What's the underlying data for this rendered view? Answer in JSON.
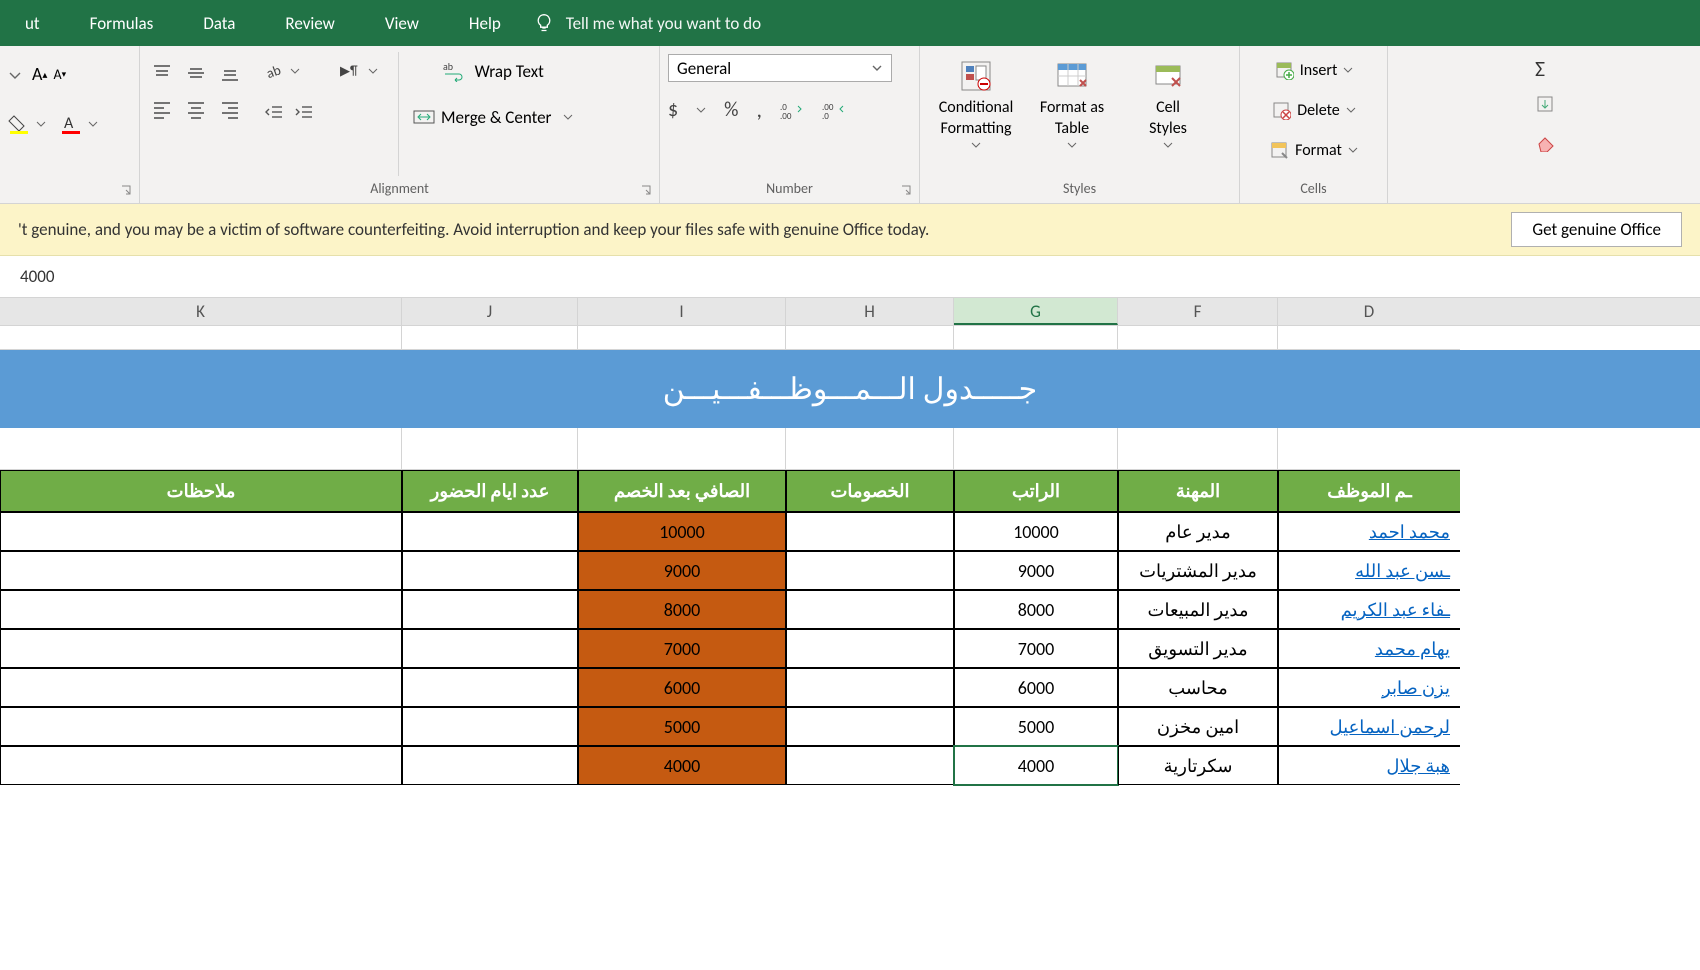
{
  "menu": {
    "tabs": [
      "ut",
      "Formulas",
      "Data",
      "Review",
      "View",
      "Help"
    ],
    "tellme": "Tell me what you want to do"
  },
  "ribbon": {
    "alignment_label": "Alignment",
    "number_label": "Number",
    "styles_label": "Styles",
    "cells_label": "Cells",
    "wrap_text": "Wrap Text",
    "merge_center": "Merge & Center",
    "number_format": "General",
    "cond_fmt": "Conditional\nFormatting",
    "fmt_table": "Format as\nTable",
    "cell_styles": "Cell\nStyles",
    "insert": "Insert",
    "delete": "Delete",
    "format": "Format"
  },
  "warning": {
    "message": "'t genuine, and you may be a victim of software counterfeiting. Avoid interruption and keep your files safe with genuine Office today.",
    "button": "Get genuine Office"
  },
  "formula_bar": "4000",
  "columns": [
    "K",
    "J",
    "I",
    "H",
    "G",
    "F",
    "D"
  ],
  "title_banner": "جـــــدول الـــمـــوظـــفـــيـــن",
  "headers": {
    "k": "ملاحظات",
    "j": "عدد ايام الحضور",
    "i": "الصافي بعد الخصم",
    "h": "الخصومات",
    "g": "الراتب",
    "f": "المهنة",
    "d": "ـم الموظف"
  },
  "rows": [
    {
      "net": "10000",
      "sal": "10000",
      "job": "مدير عام",
      "name": "محمد احمد"
    },
    {
      "net": "9000",
      "sal": "9000",
      "job": "مدير المشتريات",
      "name": "ـسن عبد الله"
    },
    {
      "net": "8000",
      "sal": "8000",
      "job": "مدير المبيعات",
      "name": "ـفاء عبد الكريم"
    },
    {
      "net": "7000",
      "sal": "7000",
      "job": "مدير التسويق",
      "name": "يهام محمد"
    },
    {
      "net": "6000",
      "sal": "6000",
      "job": "محاسب",
      "name": "يزن صابر"
    },
    {
      "net": "5000",
      "sal": "5000",
      "job": "امين مخزن",
      "name": "لرحمن اسماعيل"
    },
    {
      "net": "4000",
      "sal": "4000",
      "job": "سكرتارية",
      "name": "هبة جلال"
    }
  ],
  "selected_row_index": 6
}
